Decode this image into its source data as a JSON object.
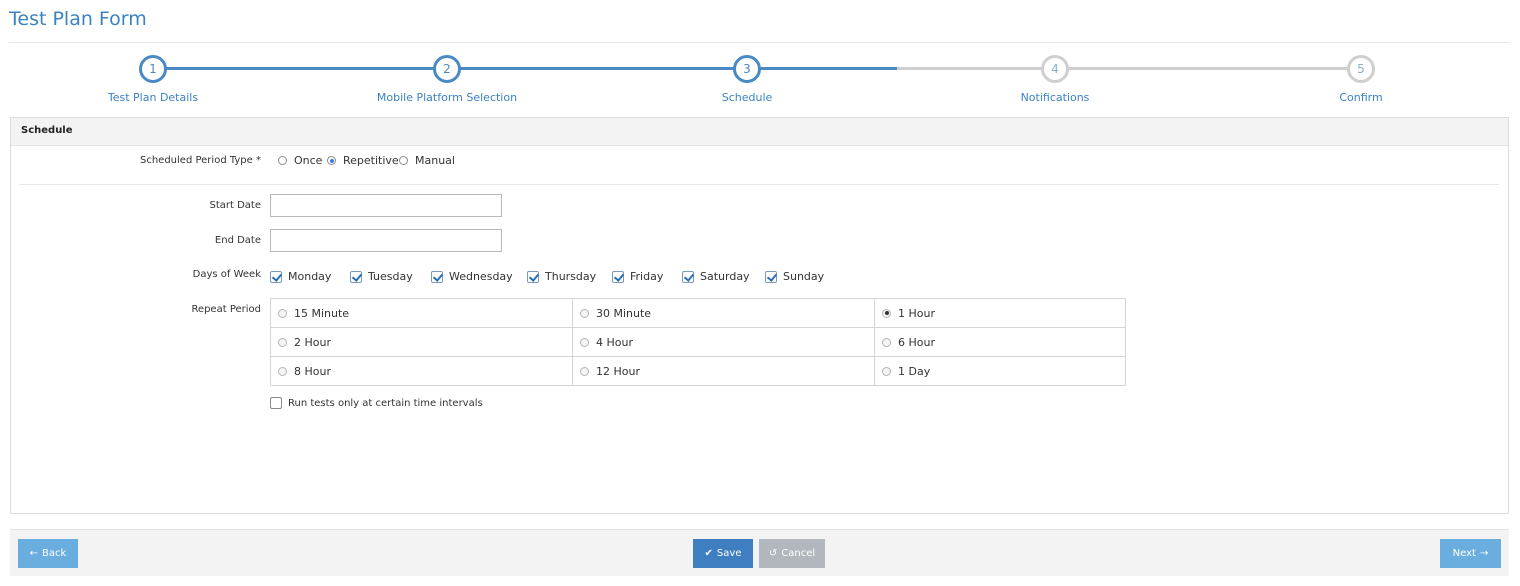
{
  "page": {
    "title": "Test Plan Form"
  },
  "wizard": {
    "current_step": 3,
    "steps": [
      {
        "number": "1",
        "label": "Test Plan Details"
      },
      {
        "number": "2",
        "label": "Mobile Platform Selection"
      },
      {
        "number": "3",
        "label": "Schedule"
      },
      {
        "number": "4",
        "label": "Notifications"
      },
      {
        "number": "5",
        "label": "Confirm"
      }
    ]
  },
  "panel": {
    "title": "Schedule"
  },
  "period_type": {
    "label": "Scheduled Period Type *",
    "options": [
      "Once",
      "Repetitive",
      "Manual"
    ],
    "selected": "Repetitive"
  },
  "start_date": {
    "label": "Start Date",
    "value": ""
  },
  "end_date": {
    "label": "End Date",
    "value": ""
  },
  "days_of_week": {
    "label": "Days of Week",
    "days": [
      {
        "name": "Monday",
        "checked": true
      },
      {
        "name": "Tuesday",
        "checked": true
      },
      {
        "name": "Wednesday",
        "checked": true
      },
      {
        "name": "Thursday",
        "checked": true
      },
      {
        "name": "Friday",
        "checked": true
      },
      {
        "name": "Saturday",
        "checked": true
      },
      {
        "name": "Sunday",
        "checked": true
      }
    ]
  },
  "repeat_period": {
    "label": "Repeat Period",
    "options": [
      "15 Minute",
      "30 Minute",
      "1 Hour",
      "2 Hour",
      "4 Hour",
      "6 Hour",
      "8 Hour",
      "12 Hour",
      "1 Day"
    ],
    "selected": "1 Hour"
  },
  "interval_option": {
    "label": "Run tests only at certain time intervals",
    "checked": false
  },
  "footer": {
    "back_label": "Back",
    "save_label": "Save",
    "cancel_label": "Cancel",
    "next_label": "Next"
  },
  "colors": {
    "accent": "#3b82c4",
    "progress_done": "#4a8ac4",
    "progress_todo": "#cfcfcf",
    "button_light": "#6aaee0",
    "button_primary": "#3f7fc1",
    "button_disabled": "#b1b7bd"
  }
}
